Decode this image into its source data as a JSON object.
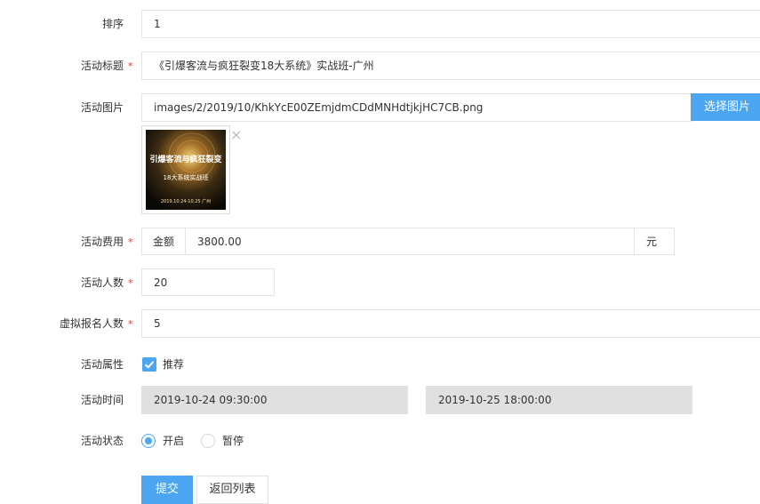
{
  "form": {
    "sort": {
      "label": "排序",
      "value": "1"
    },
    "title": {
      "label": "活动标题",
      "required_mark": "*",
      "value": "《引爆客流与疯狂裂变18大系统》实战班-广州"
    },
    "image": {
      "label": "活动图片",
      "value": "images/2/2019/10/KhkYcE00ZEmjdmCDdMNHdtjkjHC7CB.png",
      "select_button": "选择图片",
      "remove_glyph": "×",
      "thumbnail_lines": [
        "引爆客流与疯狂裂变",
        "18大系统实战班",
        "2019.10.24-10.25 广州"
      ]
    },
    "fee": {
      "label": "活动费用",
      "required_mark": "*",
      "prefix": "金额",
      "value": "3800.00",
      "suffix": "元"
    },
    "people": {
      "label": "活动人数",
      "required_mark": "*",
      "value": "20"
    },
    "virtual": {
      "label": "虚拟报名人数",
      "required_mark": "*",
      "value": "5"
    },
    "attribute": {
      "label": "活动属性",
      "option": "推荐",
      "checked": true
    },
    "time": {
      "label": "活动时间",
      "start": "2019-10-24 09:30:00",
      "end": "2019-10-25 18:00:00"
    },
    "status": {
      "label": "活动状态",
      "options": [
        "开启",
        "暂停"
      ],
      "selected": "开启"
    }
  },
  "actions": {
    "submit": "提交",
    "back": "返回列表"
  },
  "colors": {
    "accent": "#4ba5f1",
    "required": "#e4393c",
    "disabled": "#e0e0e0",
    "border": "#e5e5e5"
  }
}
